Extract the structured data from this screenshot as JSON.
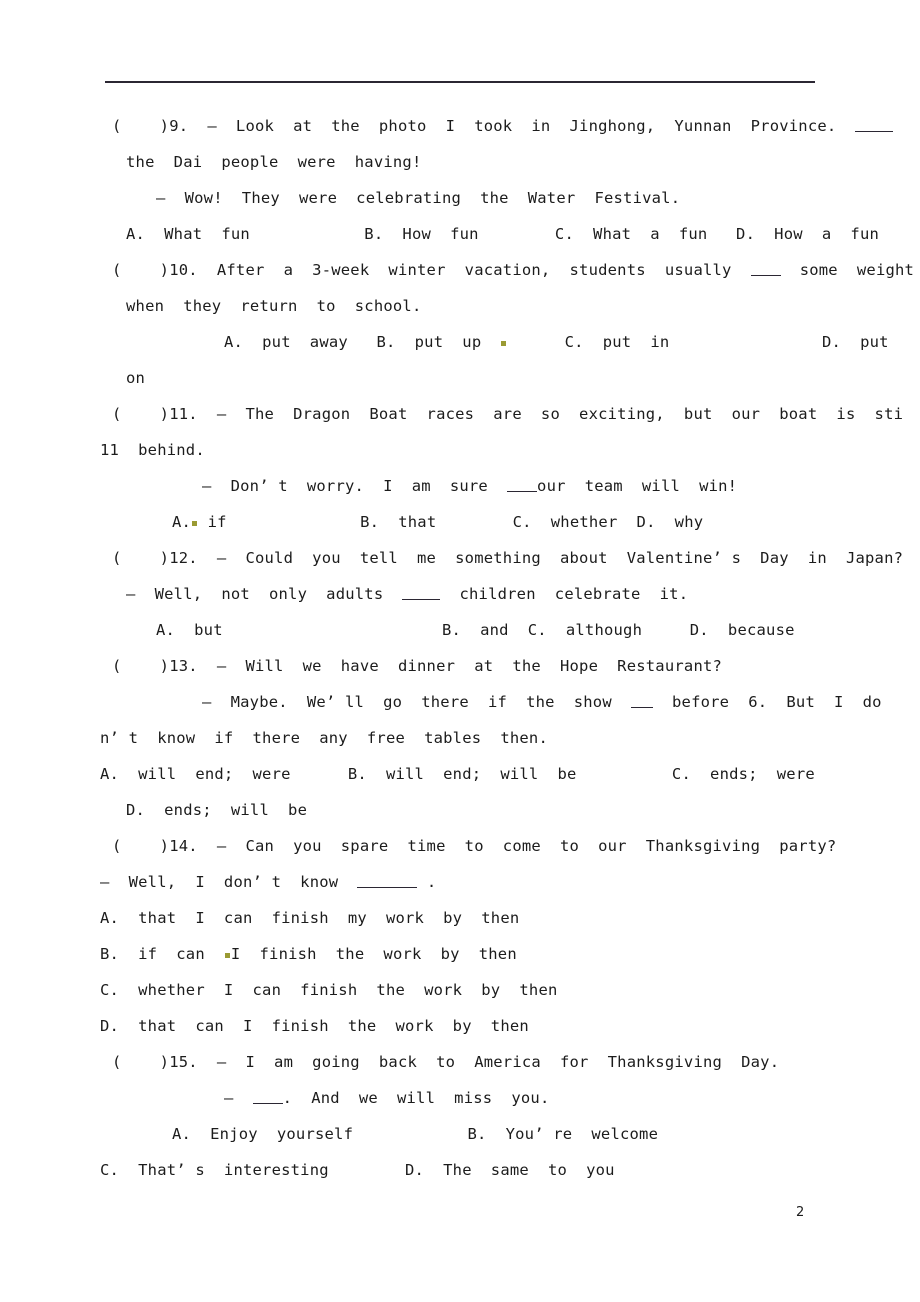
{
  "document": {
    "page_number": "2",
    "mark_color": "#9a9a33",
    "rule_color": "#2b2733"
  },
  "lines": {
    "q9_stem_1": "(    )9.  —  Look  at  the  photo  I  took  in  Jinghong,  Yunnan  Province.  ",
    "q9_stem_2": "the  Dai  people  were  having!",
    "q9_reply": "—  Wow!  They  were  celebrating  the  Water  Festival.",
    "q9_options": "A.  What  fun            B.  How  fun        C.  What  a  fun   D.  How  a  fun",
    "q10_stem_1a": "(    )10.  After  a  3-week  winter  vacation,  students  usually  ",
    "q10_stem_1b": "  some  weight",
    "q10_stem_2": "when  they  return  to  school.",
    "q10_options_a": "A.  put  away   B.  put  up  ",
    "q10_options_b": "      C.  put  in                D.  put",
    "q10_options_c": "on",
    "q11_stem_1": "(    )11.  —  The  Dragon  Boat  races  are  so  exciting,  but  our  boat  is  sti",
    "q11_stem_2": "11  behind.",
    "q11_reply_a": "—  Don’ t  worry.  I  am  sure  ",
    "q11_reply_b": "our  team  will  win!",
    "q11_options_a": "A.",
    "q11_options_b": " if              B.  that        C.  whether  D.  why",
    "q12_stem": "(    )12.  —  Could  you  tell  me  something  about  Valentine’ s  Day  in  Japan?",
    "q12_reply_a": "—  Well,  not  only  adults  ",
    "q12_reply_b": "  children  celebrate  it.",
    "q12_options": "A.  but                       B.  and  C.  although     D.  because",
    "q13_stem": "(    )13.  —  Will  we  have  dinner  at  the  Hope  Restaurant?",
    "q13_reply_a": "—  Maybe.  We’ ll  go  there  if  the  show  ",
    "q13_reply_b": "  before  6.  But  I  do",
    "q13_reply_c": "n’ t  know  if  there  any  free  tables  then.",
    "q13_options_1": "A.  will  end;  were      B.  will  end;  will  be          C.  ends;  were",
    "q13_options_2": "D.  ends;  will  be",
    "q14_stem": "(    )14.  —  Can  you  spare  time  to  come  to  our  Thanksgiving  party?",
    "q14_reply_a": "—  Well,  I  don’ t  know  ",
    "q14_reply_b": " .",
    "q14_option_a": "A.  that  I  can  finish  my  work  by  then",
    "q14_option_b1": "B.  if  can  ",
    "q14_option_b2": "I  finish  the  work  by  then",
    "q14_option_c": "C.  whether  I  can  finish  the  work  by  then",
    "q14_option_d": "D.  that  can  I  finish  the  work  by  then",
    "q15_stem": "(    )15.  —  I  am  going  back  to  America  for  Thanksgiving  Day.",
    "q15_reply_a": "—  ",
    "q15_reply_b": ".  And  we  will  miss  you.",
    "q15_options_1": "A.  Enjoy  yourself            B.  You’ re  welcome",
    "q15_options_2": "C.  That’ s  interesting        D.  The  same  to  you"
  }
}
